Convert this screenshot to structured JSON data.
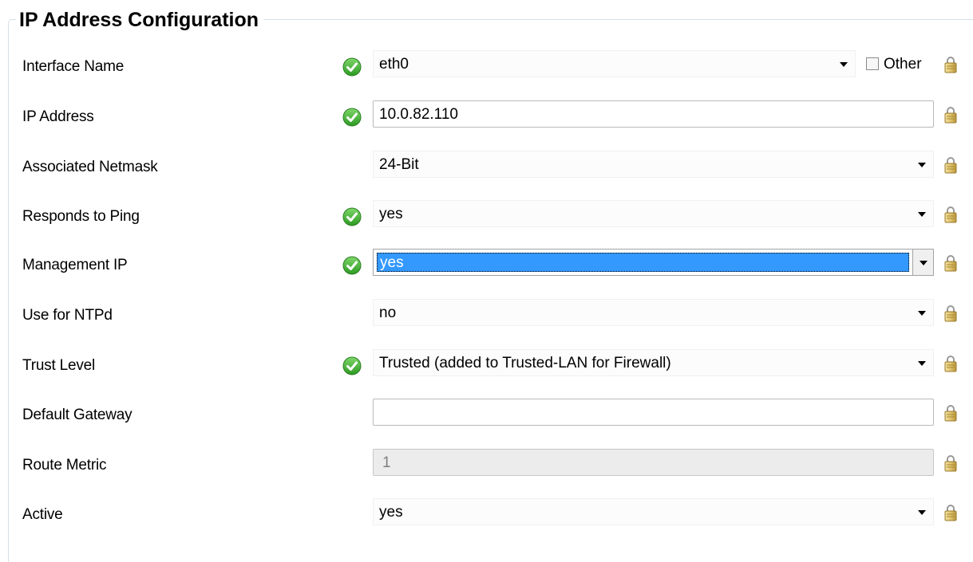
{
  "group": {
    "title": "IP Address Configuration"
  },
  "fields": [
    {
      "label": "Interface Name",
      "value": "eth0",
      "valid": true,
      "type": "combo"
    },
    {
      "label": "IP Address",
      "value": "10.0.82.110",
      "valid": true,
      "type": "text"
    },
    {
      "label": "Associated Netmask",
      "value": "24-Bit",
      "valid": false,
      "type": "combo"
    },
    {
      "label": "Responds to Ping",
      "value": "yes",
      "valid": true,
      "type": "combo"
    },
    {
      "label": "Management IP",
      "value": "yes",
      "valid": true,
      "type": "combo",
      "selected": true
    },
    {
      "label": "Use for NTPd",
      "value": "no",
      "valid": false,
      "type": "combo"
    },
    {
      "label": "Trust Level",
      "value": "Trusted (added to Trusted-LAN for Firewall)",
      "valid": true,
      "type": "combo"
    },
    {
      "label": "Default Gateway",
      "value": "",
      "valid": false,
      "type": "text"
    },
    {
      "label": "Route Metric",
      "value": "1",
      "valid": false,
      "type": "text",
      "disabled": true
    },
    {
      "label": "Active",
      "value": "yes",
      "valid": false,
      "type": "combo"
    }
  ],
  "other_checkbox": {
    "label": "Other",
    "checked": false
  },
  "icons": {
    "valid": "check-circle-icon",
    "lock": "lock-icon",
    "dropdown": "dropdown-arrow-icon"
  },
  "colors": {
    "valid_green": "#3aa62c",
    "selection_blue": "#3399ff",
    "lock_gold": "#c9a84a"
  }
}
